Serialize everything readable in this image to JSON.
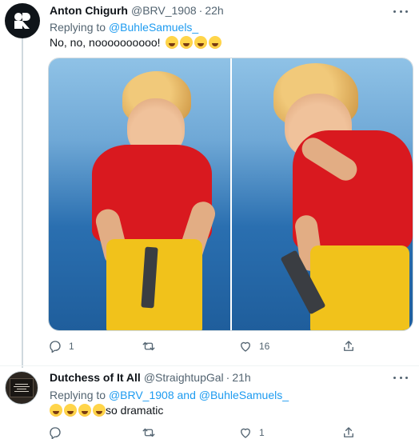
{
  "tweets": [
    {
      "display_name": "Anton Chigurh",
      "handle": "@BRV_1908",
      "separator": "·",
      "time": "22h",
      "reply_prefix": "Replying to",
      "reply_to": "@BuhleSamuels_",
      "text": "No, no, noooooooooo!",
      "emojis": [
        "loudly-crying-face",
        "loudly-crying-face",
        "loudly-crying-face",
        "loudly-crying-face"
      ],
      "reply_count": "1",
      "retweet_count": "",
      "like_count": "16"
    },
    {
      "display_name": "Dutchess of It All",
      "handle": "@StraightupGal",
      "separator": "·",
      "time": "21h",
      "reply_prefix": "Replying to",
      "reply_to": "@BRV_1908 and @BuhleSamuels_",
      "text": "so dramatic",
      "emojis": [
        "rolling-on-floor-laughing",
        "rolling-on-floor-laughing",
        "rolling-on-floor-laughing",
        "rolling-on-floor-laughing"
      ],
      "reply_count": "",
      "retweet_count": "",
      "like_count": "1"
    }
  ],
  "colors": {
    "text": "#0f1419",
    "secondary": "#536471",
    "link": "#1d9bf0",
    "divider": "#eff3f4"
  }
}
